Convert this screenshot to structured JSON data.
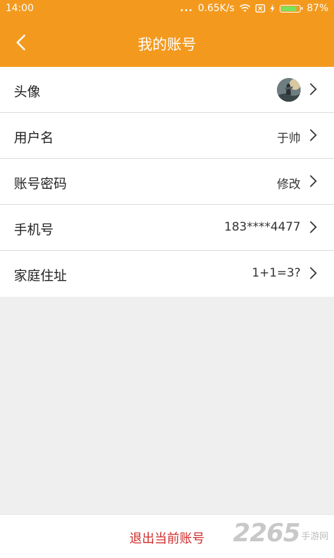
{
  "status": {
    "time": "14:00",
    "dots": "...",
    "speed": "0.65K/s",
    "battery": "87%",
    "battery_level": 0.87
  },
  "header": {
    "title": "我的账号"
  },
  "rows": [
    {
      "label": "头像",
      "value": ""
    },
    {
      "label": "用户名",
      "value": "于帅"
    },
    {
      "label": "账号密码",
      "value": "修改"
    },
    {
      "label": "手机号",
      "value": "183****4477"
    },
    {
      "label": "家庭住址",
      "value": "1+1=3?"
    }
  ],
  "footer": {
    "logout_label": "退出当前账号"
  },
  "watermark": {
    "number": "2265",
    "site": "手游网"
  },
  "colors": {
    "accent": "#f39a1e",
    "danger": "#d02b2b"
  }
}
